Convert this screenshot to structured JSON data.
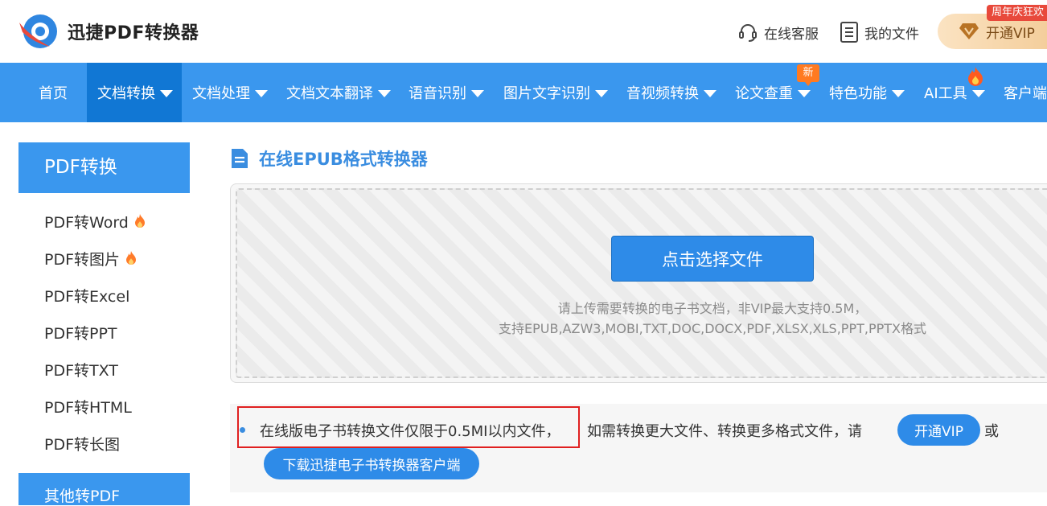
{
  "header": {
    "app_name": "迅捷PDF转换器",
    "links": {
      "service": "在线客服",
      "files": "我的文件"
    },
    "vip_button": "开通VIP",
    "promo_badge": "周年庆狂欢"
  },
  "nav": {
    "items": [
      {
        "label": "首页"
      },
      {
        "label": "文档转换"
      },
      {
        "label": "文档处理"
      },
      {
        "label": "文档文本翻译"
      },
      {
        "label": "语音识别"
      },
      {
        "label": "图片文字识别"
      },
      {
        "label": "音视频转换"
      },
      {
        "label": "论文查重"
      },
      {
        "label": "特色功能"
      },
      {
        "label": "AI工具"
      },
      {
        "label": "客户端"
      }
    ],
    "new_badge": "新"
  },
  "sidebar": {
    "title": "PDF转换",
    "items": [
      {
        "label": "PDF转Word"
      },
      {
        "label": "PDF转图片"
      },
      {
        "label": "PDF转Excel"
      },
      {
        "label": "PDF转PPT"
      },
      {
        "label": "PDF转TXT"
      },
      {
        "label": "PDF转HTML"
      },
      {
        "label": "PDF转长图"
      }
    ],
    "next_section": "其他转PDF"
  },
  "main": {
    "title": "在线EPUB格式转换器",
    "choose_button": "点击选择文件",
    "hint_line1": "请上传需要转换的电子书文档，非VIP最大支持0.5M，",
    "hint_line2": "支持EPUB,AZW3,MOBI,TXT,DOC,DOCX,PDF,XLSX,XLS,PPT,PPTX格式",
    "notice": {
      "limit_text": "在线版电子书转换文件仅限于0.5MI以内文件，",
      "more_text": "如需转换更大文件、转换更多格式文件，请",
      "vip_button": "开通VIP",
      "or_text": "或",
      "download_button": "下载迅捷电子书转换器客户端"
    }
  },
  "colors": {
    "brand_blue": "#3a97ee",
    "active_nav": "#1177d4",
    "highlight_red": "#e02020"
  }
}
